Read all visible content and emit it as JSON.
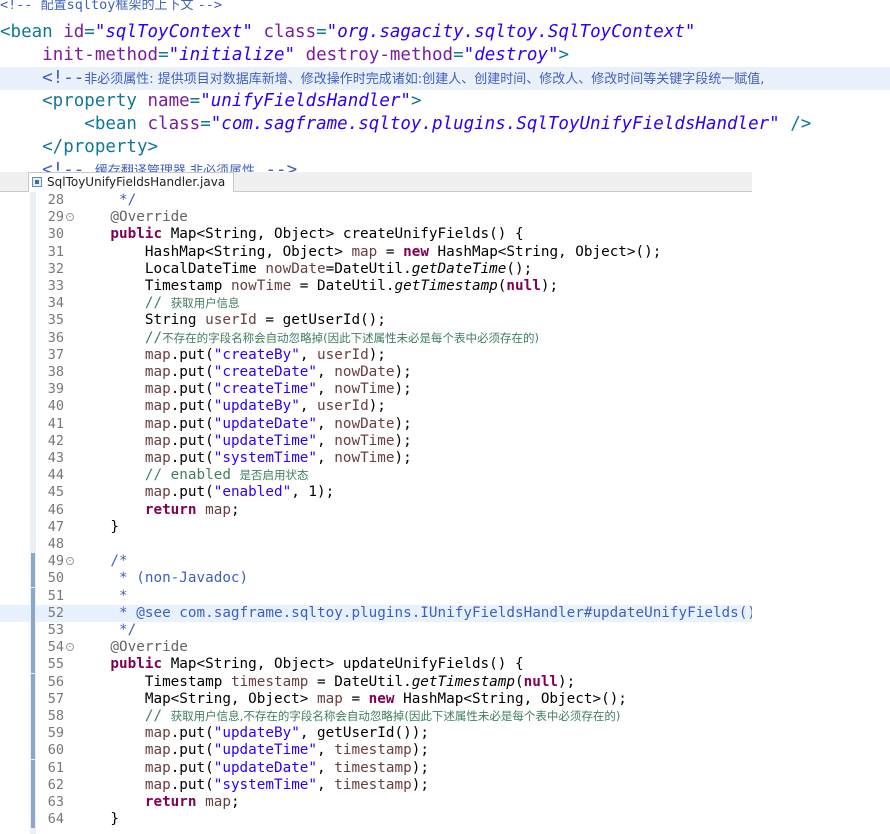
{
  "xml_lines": [
    {
      "segs": [
        [
          "cmt",
          "<!-- "
        ],
        [
          "cmtcjk",
          "配置"
        ],
        [
          "cmt",
          "sqltoy"
        ],
        [
          "cmtcjk",
          "框架的上下文 "
        ],
        [
          "cmt",
          "-->"
        ]
      ],
      "small": true
    },
    {
      "segs": [
        [
          "tag",
          "<bean "
        ],
        [
          "attr",
          "id"
        ],
        [
          "tag",
          "="
        ],
        [
          "val",
          "\"sqlToyContext\""
        ],
        [
          "tag",
          " "
        ],
        [
          "attr",
          "class"
        ],
        [
          "tag",
          "="
        ],
        [
          "val",
          "\"org.sagacity.sqltoy.SqlToyContext\""
        ]
      ]
    },
    {
      "segs": [
        [
          "tag",
          "    "
        ],
        [
          "attr",
          "init-method"
        ],
        [
          "tag",
          "="
        ],
        [
          "val",
          "\"initialize\""
        ],
        [
          "tag",
          " "
        ],
        [
          "attr",
          "destroy-method"
        ],
        [
          "tag",
          "="
        ],
        [
          "val",
          "\"destroy\""
        ],
        [
          "tag",
          ">"
        ]
      ]
    },
    {
      "segs": [
        [
          "cmt",
          "    <!--"
        ],
        [
          "cmtcjk",
          "非必须属性: 提供项目对数据库新增、修改操作时完成诸如:创建人、创建时间、修改人、修改时间等关键字段统一赋值,"
        ]
      ],
      "hl": true
    },
    {
      "segs": [
        [
          "tag",
          "    <property "
        ],
        [
          "attr",
          "name"
        ],
        [
          "tag",
          "="
        ],
        [
          "val",
          "\"unifyFieldsHandler\""
        ],
        [
          "tag",
          ">"
        ]
      ]
    },
    {
      "segs": [
        [
          "tag",
          "        <bean "
        ],
        [
          "attr",
          "class"
        ],
        [
          "tag",
          "="
        ],
        [
          "val",
          "\"com.sagframe.sqltoy.plugins.SqlToyUnifyFieldsHandler\""
        ],
        [
          "tag",
          " />"
        ]
      ]
    },
    {
      "segs": [
        [
          "tag",
          "    </property>"
        ]
      ]
    },
    {
      "segs": [
        [
          "cmt",
          "    <!-- "
        ],
        [
          "cmtcjk",
          "缓存翻译管理器,非必须属性"
        ],
        [
          "cmt",
          " -->"
        ]
      ]
    }
  ],
  "editor": {
    "tab_label": "SqlToyUnifyFieldsHandler.java"
  },
  "code_lines": [
    {
      "n": "28",
      "segs": [
        [
          "jd",
          "     */"
        ]
      ]
    },
    {
      "n": "29",
      "fold": "-",
      "segs": [
        [
          "ann",
          "    @Override"
        ]
      ]
    },
    {
      "n": "30",
      "segs": [
        [
          "kw",
          "    public "
        ],
        [
          "",
          "Map<String, Object> createUnifyFields() {"
        ]
      ]
    },
    {
      "n": "31",
      "segs": [
        [
          "",
          "        HashMap<String, Object> "
        ],
        [
          "lv",
          "map"
        ],
        [
          "",
          " = "
        ],
        [
          "kw",
          "new "
        ],
        [
          "",
          "HashMap<String, Object>();"
        ]
      ]
    },
    {
      "n": "32",
      "segs": [
        [
          "",
          "        LocalDateTime "
        ],
        [
          "lv",
          "nowDate"
        ],
        [
          "",
          "=DateUtil."
        ],
        [
          "sm",
          "getDateTime"
        ],
        [
          "",
          "();"
        ]
      ]
    },
    {
      "n": "33",
      "segs": [
        [
          "",
          "        Timestamp "
        ],
        [
          "lv",
          "nowTime"
        ],
        [
          "",
          " = DateUtil."
        ],
        [
          "sm",
          "getTimestamp"
        ],
        [
          "",
          "("
        ],
        [
          "kw",
          "null"
        ],
        [
          "",
          ");"
        ]
      ]
    },
    {
      "n": "34",
      "segs": [
        [
          "cm",
          "        // "
        ],
        [
          "cm cjk",
          "获取用户信息"
        ]
      ]
    },
    {
      "n": "35",
      "segs": [
        [
          "",
          "        String "
        ],
        [
          "lv",
          "userId"
        ],
        [
          "",
          " = getUserId();"
        ]
      ]
    },
    {
      "n": "36",
      "segs": [
        [
          "cm",
          "        //"
        ],
        [
          "cm cjk",
          "不存在的字段名称会自动忽略掉(因此下述属性未必是每个表中必须存在的)"
        ]
      ]
    },
    {
      "n": "37",
      "segs": [
        [
          "lv",
          "        map"
        ],
        [
          "",
          ".put("
        ],
        [
          "str",
          "\"createBy\""
        ],
        [
          "",
          ", "
        ],
        [
          "lv",
          "userId"
        ],
        [
          "",
          ");"
        ]
      ]
    },
    {
      "n": "38",
      "segs": [
        [
          "lv",
          "        map"
        ],
        [
          "",
          ".put("
        ],
        [
          "str",
          "\"createDate\""
        ],
        [
          "",
          ", "
        ],
        [
          "lv",
          "nowDate"
        ],
        [
          "",
          ");"
        ]
      ]
    },
    {
      "n": "39",
      "segs": [
        [
          "lv",
          "        map"
        ],
        [
          "",
          ".put("
        ],
        [
          "str",
          "\"createTime\""
        ],
        [
          "",
          ", "
        ],
        [
          "lv",
          "nowTime"
        ],
        [
          "",
          ");"
        ]
      ]
    },
    {
      "n": "40",
      "segs": [
        [
          "lv",
          "        map"
        ],
        [
          "",
          ".put("
        ],
        [
          "str",
          "\"updateBy\""
        ],
        [
          "",
          ", "
        ],
        [
          "lv",
          "userId"
        ],
        [
          "",
          ");"
        ]
      ]
    },
    {
      "n": "41",
      "segs": [
        [
          "lv",
          "        map"
        ],
        [
          "",
          ".put("
        ],
        [
          "str",
          "\"updateDate\""
        ],
        [
          "",
          ", "
        ],
        [
          "lv",
          "nowDate"
        ],
        [
          "",
          ");"
        ]
      ]
    },
    {
      "n": "42",
      "segs": [
        [
          "lv",
          "        map"
        ],
        [
          "",
          ".put("
        ],
        [
          "str",
          "\"updateTime\""
        ],
        [
          "",
          ", "
        ],
        [
          "lv",
          "nowTime"
        ],
        [
          "",
          ");"
        ]
      ]
    },
    {
      "n": "43",
      "segs": [
        [
          "lv",
          "        map"
        ],
        [
          "",
          ".put("
        ],
        [
          "str",
          "\"systemTime\""
        ],
        [
          "",
          ", "
        ],
        [
          "lv",
          "nowTime"
        ],
        [
          "",
          ");"
        ]
      ]
    },
    {
      "n": "44",
      "segs": [
        [
          "cm",
          "        // enabled "
        ],
        [
          "cm cjk",
          "是否启用状态"
        ]
      ]
    },
    {
      "n": "45",
      "segs": [
        [
          "lv",
          "        map"
        ],
        [
          "",
          ".put("
        ],
        [
          "str",
          "\"enabled\""
        ],
        [
          "",
          ", 1);"
        ]
      ]
    },
    {
      "n": "46",
      "segs": [
        [
          "kw",
          "        return "
        ],
        [
          "lv",
          "map"
        ],
        [
          "",
          ";"
        ]
      ]
    },
    {
      "n": "47",
      "segs": [
        [
          "",
          "    }"
        ]
      ]
    },
    {
      "n": "48",
      "segs": []
    },
    {
      "n": "49",
      "fold": "-",
      "segs": [
        [
          "jd",
          "    /*"
        ]
      ]
    },
    {
      "n": "50",
      "segs": [
        [
          "jd",
          "     * (non-Javadoc)"
        ]
      ]
    },
    {
      "n": "51",
      "segs": [
        [
          "jd",
          "     *"
        ]
      ]
    },
    {
      "n": "52",
      "hl": true,
      "segs": [
        [
          "jd",
          "     * @see com.sagframe.sqltoy.plugins.IUnifyFieldsHandler#updateUnifyFields()"
        ]
      ]
    },
    {
      "n": "53",
      "segs": [
        [
          "jd",
          "     */"
        ]
      ]
    },
    {
      "n": "54",
      "fold": "-",
      "segs": [
        [
          "ann",
          "    @Override"
        ]
      ]
    },
    {
      "n": "55",
      "segs": [
        [
          "kw",
          "    public "
        ],
        [
          "",
          "Map<String, Object> updateUnifyFields() {"
        ]
      ]
    },
    {
      "n": "56",
      "segs": [
        [
          "",
          "        Timestamp "
        ],
        [
          "lv",
          "timestamp"
        ],
        [
          "",
          " = DateUtil."
        ],
        [
          "sm",
          "getTimestamp"
        ],
        [
          "",
          "("
        ],
        [
          "kw",
          "null"
        ],
        [
          "",
          ");"
        ]
      ]
    },
    {
      "n": "57",
      "segs": [
        [
          "",
          "        Map<String, Object> "
        ],
        [
          "lv",
          "map"
        ],
        [
          "",
          " = "
        ],
        [
          "kw",
          "new "
        ],
        [
          "",
          "HashMap<String, Object>();"
        ]
      ]
    },
    {
      "n": "58",
      "segs": [
        [
          "cm",
          "        // "
        ],
        [
          "cm cjk",
          "获取用户信息,不存在的字段名称会自动忽略掉(因此下述属性未必是每个表中必须存在的)"
        ]
      ]
    },
    {
      "n": "59",
      "segs": [
        [
          "lv",
          "        map"
        ],
        [
          "",
          ".put("
        ],
        [
          "str",
          "\"updateBy\""
        ],
        [
          "",
          ", getUserId());"
        ]
      ]
    },
    {
      "n": "60",
      "segs": [
        [
          "lv",
          "        map"
        ],
        [
          "",
          ".put("
        ],
        [
          "str",
          "\"updateTime\""
        ],
        [
          "",
          ", "
        ],
        [
          "lv",
          "timestamp"
        ],
        [
          "",
          ");"
        ]
      ]
    },
    {
      "n": "61",
      "segs": [
        [
          "lv",
          "        map"
        ],
        [
          "",
          ".put("
        ],
        [
          "str",
          "\"updateDate\""
        ],
        [
          "",
          ", "
        ],
        [
          "lv",
          "timestamp"
        ],
        [
          "",
          ");"
        ]
      ]
    },
    {
      "n": "62",
      "segs": [
        [
          "lv",
          "        map"
        ],
        [
          "",
          ".put("
        ],
        [
          "str",
          "\"systemTime\""
        ],
        [
          "",
          ", "
        ],
        [
          "lv",
          "timestamp"
        ],
        [
          "",
          ");"
        ]
      ]
    },
    {
      "n": "63",
      "segs": [
        [
          "kw",
          "        return "
        ],
        [
          "lv",
          "map"
        ],
        [
          "",
          ";"
        ]
      ]
    },
    {
      "n": "64",
      "segs": [
        [
          "",
          "    }"
        ]
      ]
    }
  ],
  "colors": {
    "keyword": "#7f0055",
    "string": "#2a00ff",
    "comment": "#3f7f5f",
    "javadoc": "#3f5fbf",
    "annotation": "#646464",
    "xml_tag": "#117799",
    "xml_attr": "#7d1a9f"
  }
}
